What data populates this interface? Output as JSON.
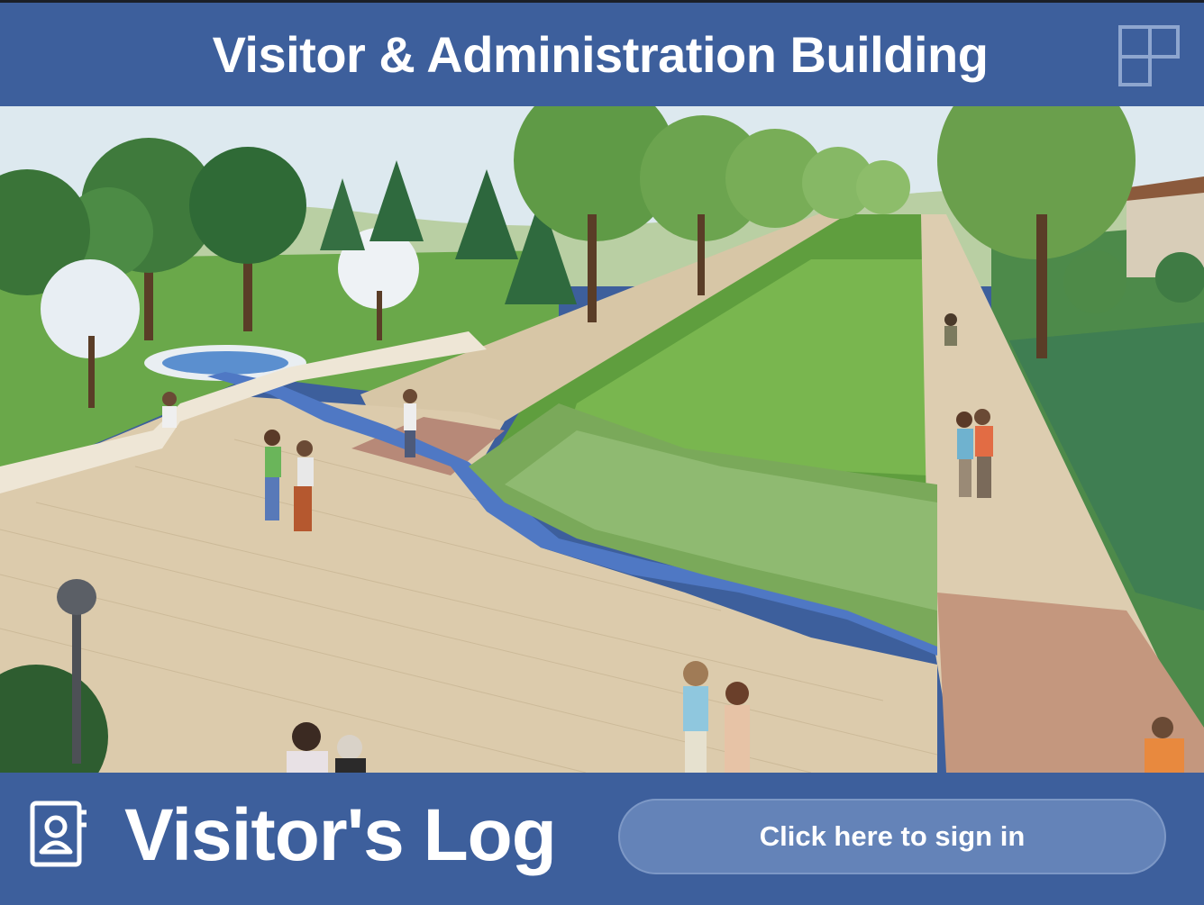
{
  "header": {
    "title": "Visitor & Administration Building",
    "layout_icon": "layout-grid-icon"
  },
  "scene": {
    "description_icon": "illustration",
    "image_name": "landscape-rendering"
  },
  "footer": {
    "log_icon": "contact-book-icon",
    "log_title": "Visitor's Log",
    "signin_label": "Click here to sign in"
  },
  "colors": {
    "brand_blue": "#3d5f9c",
    "button_fill": "#6483b8",
    "button_border": "#7d98c6",
    "text": "#ffffff"
  }
}
